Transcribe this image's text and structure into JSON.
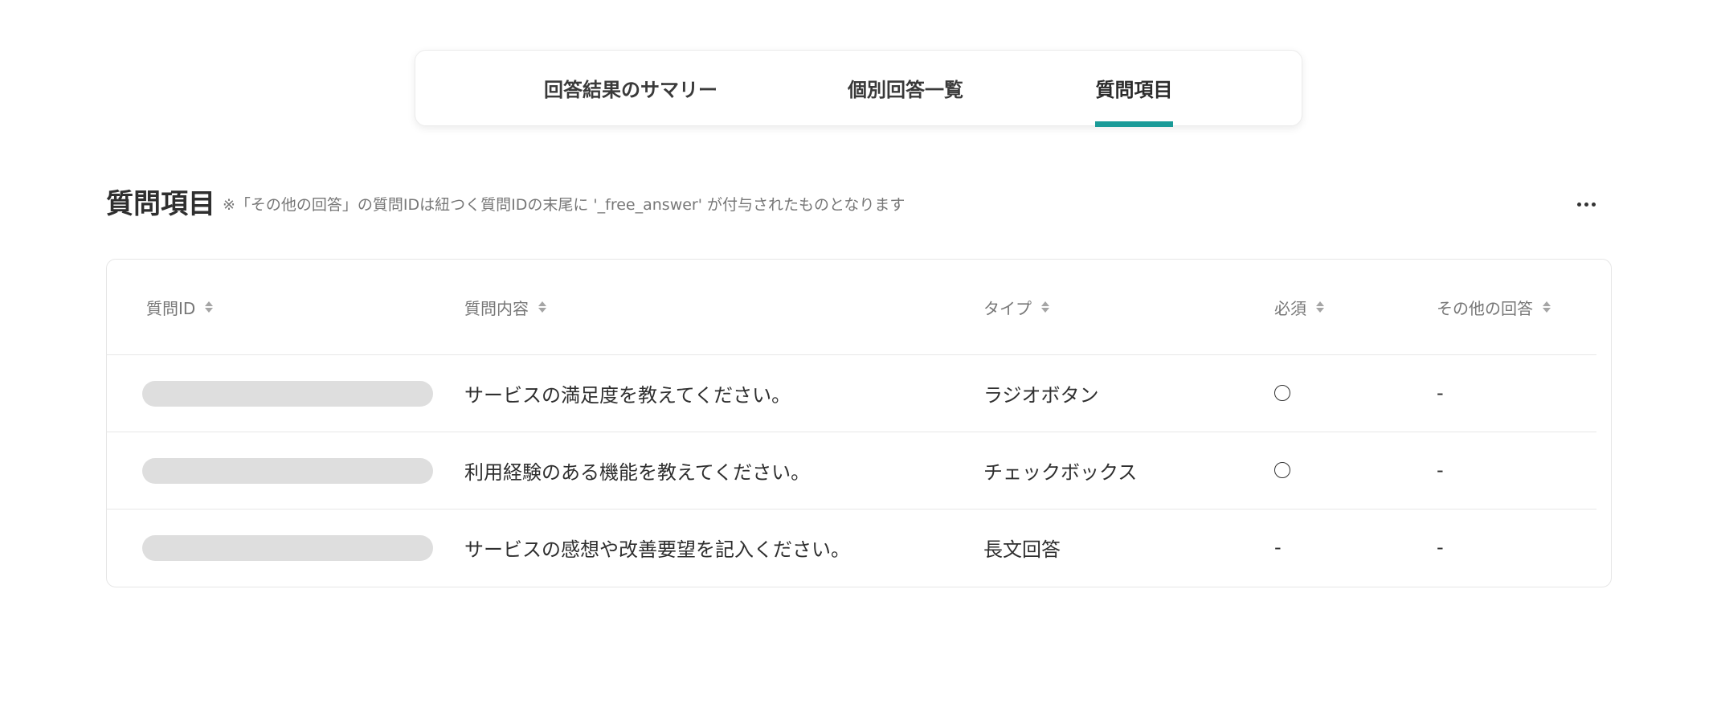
{
  "tabs": [
    {
      "label": "回答結果のサマリー",
      "active": false
    },
    {
      "label": "個別回答一覧",
      "active": false
    },
    {
      "label": "質問項目",
      "active": true
    }
  ],
  "accent_color": "#1a9b98",
  "section": {
    "title": "質問項目",
    "note": "※「その他の回答」の質問IDは紐つく質問IDの末尾に '_free_answer' が付与されたものとなります",
    "more_icon": "ellipsis-icon"
  },
  "table": {
    "columns": [
      "質問ID",
      "質問内容",
      "タイプ",
      "必須",
      "その他の回答"
    ],
    "rows": [
      {
        "question": "サービスの満足度を教えてください。",
        "type": "ラジオボタン",
        "required": "circle",
        "other": "-"
      },
      {
        "question": "利用経験のある機能を教えてください。",
        "type": "チェックボックス",
        "required": "circle",
        "other": "-"
      },
      {
        "question": "サービスの感想や改善要望を記入ください。",
        "type": "長文回答",
        "required": "-",
        "other": "-"
      }
    ]
  }
}
